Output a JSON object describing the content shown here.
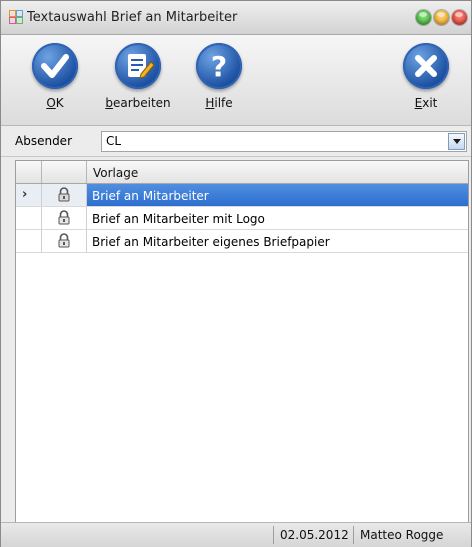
{
  "window": {
    "title": "Textauswahl Brief an Mitarbeiter"
  },
  "toolbar": {
    "buttons": [
      {
        "name": "ok",
        "label": "OK",
        "mnemonic": "O",
        "rest": "K",
        "icon": "checkmark-icon"
      },
      {
        "name": "edit",
        "label": "bearbeiten",
        "mnemonic": "b",
        "rest": "earbeiten",
        "icon": "edit-document-icon"
      },
      {
        "name": "help",
        "label": "Hilfe",
        "mnemonic": "H",
        "rest": "ilfe",
        "icon": "question-icon"
      },
      {
        "name": "exit",
        "label": "Exit",
        "mnemonic": "E",
        "rest": "xit",
        "icon": "close-icon"
      }
    ]
  },
  "sender": {
    "label": "Absender",
    "value": "CL"
  },
  "grid": {
    "columns": [
      "",
      "",
      "Vorlage"
    ],
    "rows": [
      {
        "indicator": "›",
        "icon": "lock-icon",
        "name": "Brief an Mitarbeiter",
        "selected": true
      },
      {
        "indicator": "",
        "icon": "lock-icon",
        "name": "Brief an Mitarbeiter mit Logo",
        "selected": false
      },
      {
        "indicator": "",
        "icon": "lock-icon",
        "name": "Brief an Mitarbeiter eigenes Briefpapier",
        "selected": false
      }
    ]
  },
  "status": {
    "date": "02.05.2012",
    "user": "Matteo Rogge"
  },
  "colors": {
    "accent": "#2d6fd0",
    "button_blue": "#1b4fa0",
    "traffic_green": "#3fbf3a",
    "traffic_yellow": "#f1b531",
    "traffic_red": "#e04436"
  }
}
